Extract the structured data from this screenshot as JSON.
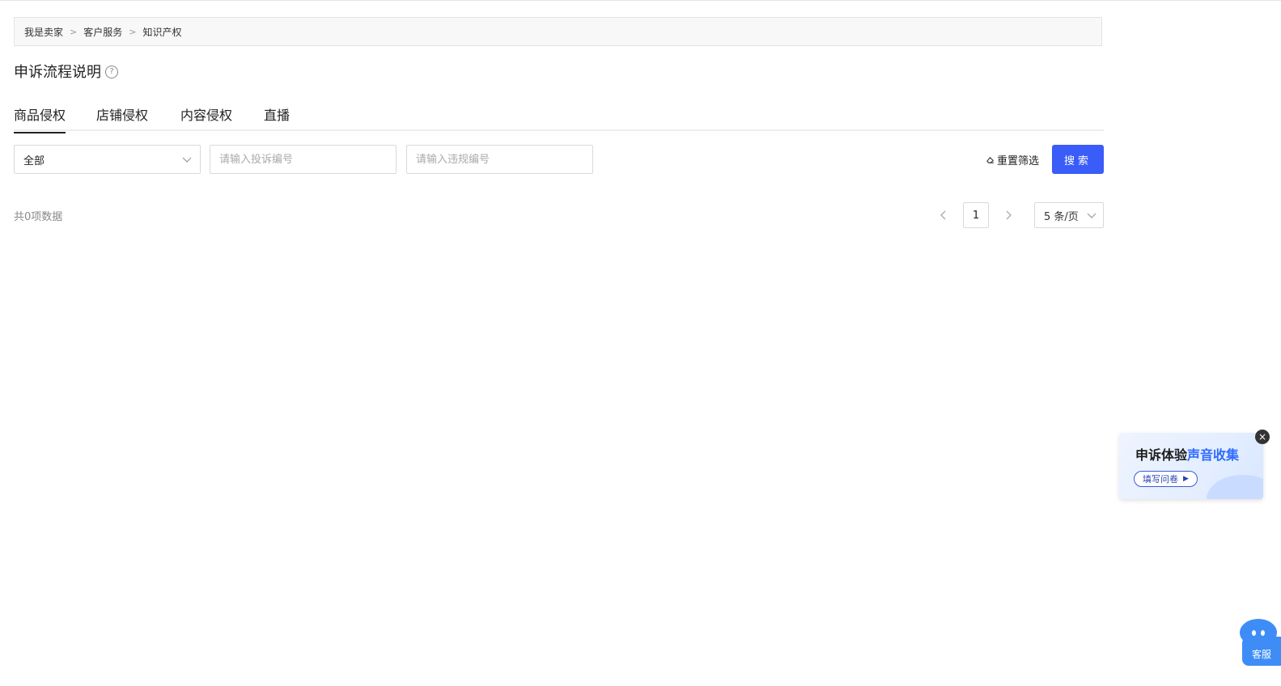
{
  "breadcrumb": {
    "items": [
      "我是卖家",
      "客户服务",
      "知识产权"
    ],
    "separator": ">"
  },
  "title": {
    "text": "申诉流程说明",
    "help_icon": "question-circle-icon"
  },
  "tabs": [
    {
      "label": "商品侵权",
      "active": true
    },
    {
      "label": "店铺侵权",
      "active": false
    },
    {
      "label": "内容侵权",
      "active": false
    },
    {
      "label": "直播",
      "active": false
    }
  ],
  "filters": {
    "type_select_value": "全部",
    "complaint_no_placeholder": "请输入投诉编号",
    "violation_no_placeholder": "请输入违规编号",
    "reset_label": "重置筛选",
    "search_label": "搜索"
  },
  "list": {
    "total_text": "共0项数据"
  },
  "pagination": {
    "current_page": "1",
    "page_size": "5 条/页"
  },
  "survey_banner": {
    "title_part1": "申诉体验",
    "title_part2": "声音收集",
    "button_label": "填写问卷",
    "close_symbol": "×"
  },
  "customer_service": {
    "label": "客服"
  },
  "colors": {
    "primary": "#3a5cf8",
    "highlight": "#2f6bff",
    "cs_blue": "#3e8df7"
  }
}
